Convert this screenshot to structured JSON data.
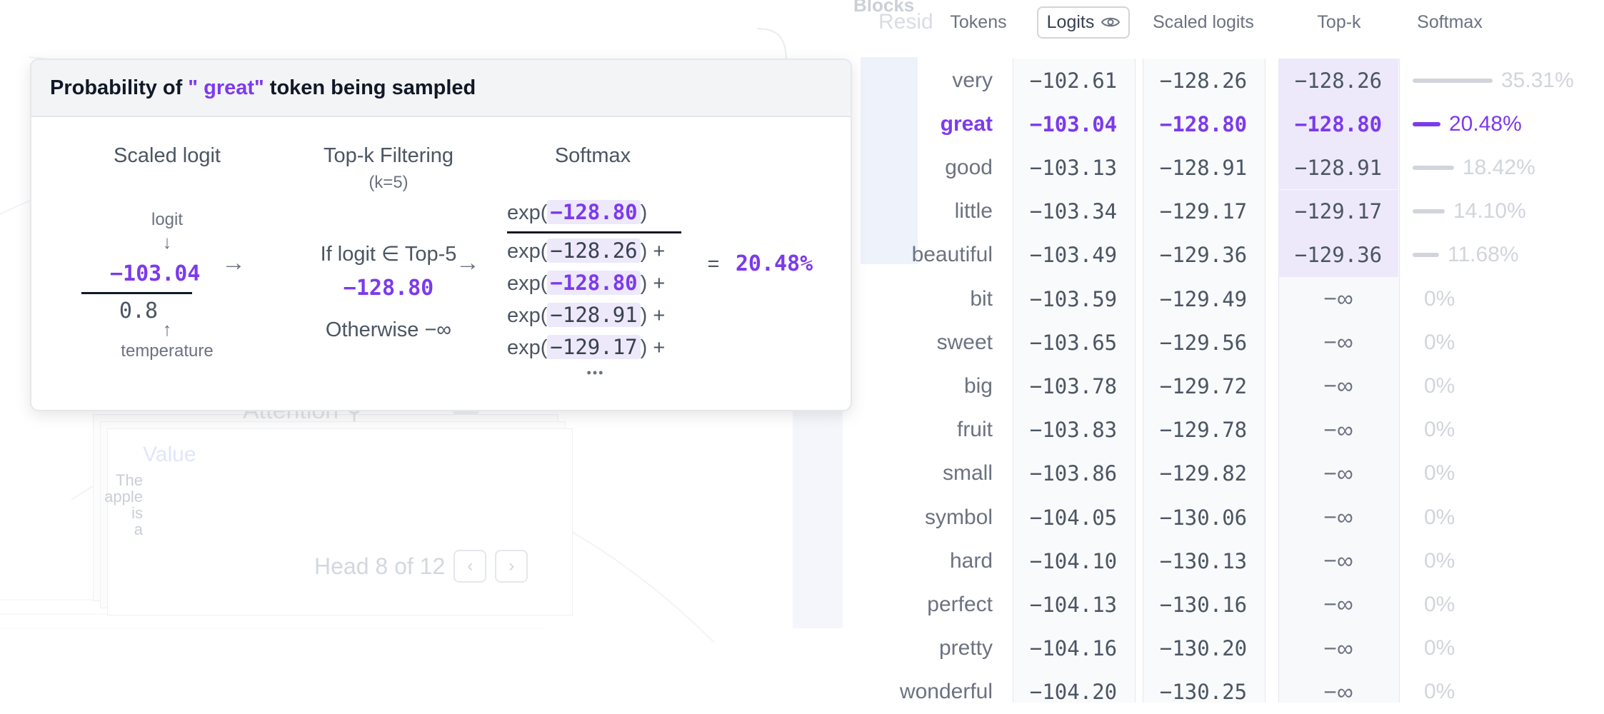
{
  "background": {
    "blocks_label": "Blocks",
    "resid_label": "Resid",
    "attention_label": "Attention",
    "value_label": "Value",
    "tokens": [
      "The",
      "apple",
      "is",
      "a"
    ],
    "head_label": "Head 8 of 12"
  },
  "header": {
    "tokens": "Tokens",
    "logits": "Logits",
    "scaled_logits": "Scaled logits",
    "topk": "Top-k",
    "softmax": "Softmax"
  },
  "rows": [
    {
      "token": "very",
      "logit": "−102.61",
      "scaled": "−128.26",
      "topk": "−128.26",
      "softmax": "35.31%",
      "prob": 0.3531,
      "in_topk": true,
      "selected": false
    },
    {
      "token": "great",
      "logit": "−103.04",
      "scaled": "−128.80",
      "topk": "−128.80",
      "softmax": "20.48%",
      "prob": 0.2048,
      "in_topk": true,
      "selected": true
    },
    {
      "token": "good",
      "logit": "−103.13",
      "scaled": "−128.91",
      "topk": "−128.91",
      "softmax": "18.42%",
      "prob": 0.1842,
      "in_topk": true,
      "selected": false
    },
    {
      "token": "little",
      "logit": "−103.34",
      "scaled": "−129.17",
      "topk": "−129.17",
      "softmax": "14.10%",
      "prob": 0.141,
      "in_topk": true,
      "selected": false
    },
    {
      "token": "beautiful",
      "logit": "−103.49",
      "scaled": "−129.36",
      "topk": "−129.36",
      "softmax": "11.68%",
      "prob": 0.1168,
      "in_topk": true,
      "selected": false
    },
    {
      "token": "bit",
      "logit": "−103.59",
      "scaled": "−129.49",
      "topk": "−∞",
      "softmax": "0%",
      "prob": 0,
      "in_topk": false,
      "selected": false
    },
    {
      "token": "sweet",
      "logit": "−103.65",
      "scaled": "−129.56",
      "topk": "−∞",
      "softmax": "0%",
      "prob": 0,
      "in_topk": false,
      "selected": false
    },
    {
      "token": "big",
      "logit": "−103.78",
      "scaled": "−129.72",
      "topk": "−∞",
      "softmax": "0%",
      "prob": 0,
      "in_topk": false,
      "selected": false
    },
    {
      "token": "fruit",
      "logit": "−103.83",
      "scaled": "−129.78",
      "topk": "−∞",
      "softmax": "0%",
      "prob": 0,
      "in_topk": false,
      "selected": false
    },
    {
      "token": "small",
      "logit": "−103.86",
      "scaled": "−129.82",
      "topk": "−∞",
      "softmax": "0%",
      "prob": 0,
      "in_topk": false,
      "selected": false
    },
    {
      "token": "symbol",
      "logit": "−104.05",
      "scaled": "−130.06",
      "topk": "−∞",
      "softmax": "0%",
      "prob": 0,
      "in_topk": false,
      "selected": false
    },
    {
      "token": "hard",
      "logit": "−104.10",
      "scaled": "−130.13",
      "topk": "−∞",
      "softmax": "0%",
      "prob": 0,
      "in_topk": false,
      "selected": false
    },
    {
      "token": "perfect",
      "logit": "−104.13",
      "scaled": "−130.16",
      "topk": "−∞",
      "softmax": "0%",
      "prob": 0,
      "in_topk": false,
      "selected": false
    },
    {
      "token": "pretty",
      "logit": "−104.16",
      "scaled": "−130.20",
      "topk": "−∞",
      "softmax": "0%",
      "prob": 0,
      "in_topk": false,
      "selected": false
    },
    {
      "token": "wonderful",
      "logit": "−104.20",
      "scaled": "−130.25",
      "topk": "−∞",
      "softmax": "0%",
      "prob": 0,
      "in_topk": false,
      "selected": false
    }
  ],
  "card": {
    "title_prefix": "Probability of",
    "title_token": "\" great\"",
    "title_suffix": "token being sampled",
    "scaled_title": "Scaled logit",
    "logit_label": "logit",
    "logit_value": "−103.04",
    "temperature_value": "0.8",
    "temperature_label": "temperature",
    "topk_title": "Top-k Filtering",
    "topk_k": "(k=5)",
    "topk_condition": "If logit ∈ Top-5",
    "topk_value": "−128.80",
    "topk_otherwise": "Otherwise −∞",
    "softmax_title": "Softmax",
    "exp_prefix": "exp(",
    "exp_close": ")",
    "exp_close_plus": ") +",
    "numerator": "−128.80",
    "denominator": [
      "−128.26",
      "−128.80",
      "−128.91",
      "−129.17"
    ],
    "ellipsis": "•••",
    "equals": "=",
    "result": "20.48%",
    "arrow": "→",
    "down_arrow": "↓",
    "up_arrow": "↑"
  },
  "colors": {
    "accent": "#7c3aed",
    "highlight": "#ede9fb",
    "muted": "#d1d5db"
  }
}
